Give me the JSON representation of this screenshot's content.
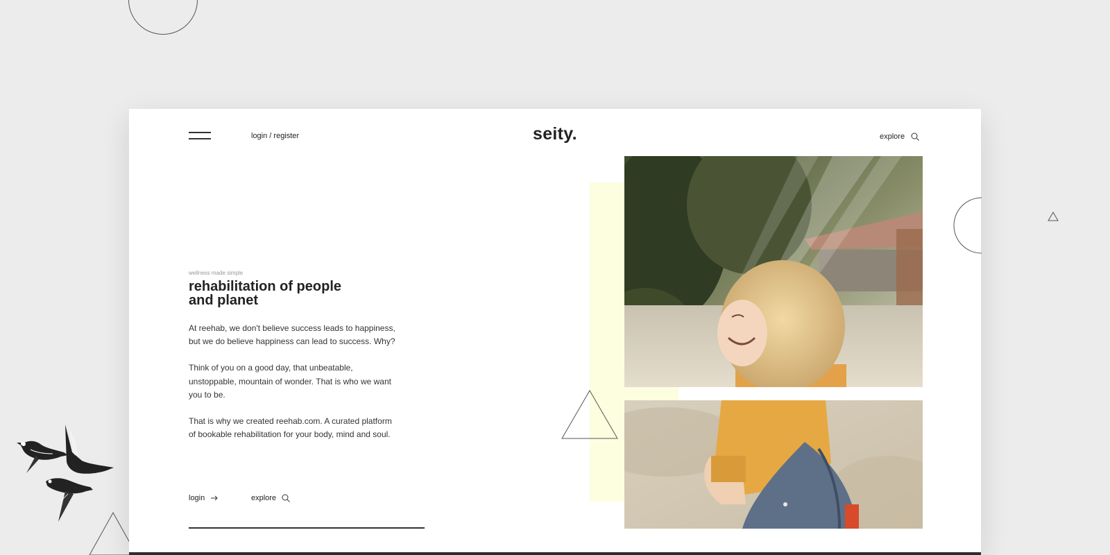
{
  "header": {
    "login_register": "login / register",
    "logo": "seity.",
    "explore": "explore"
  },
  "hero": {
    "eyebrow": "wellness made simple",
    "headline_line1": "rehabilitation of people",
    "headline_line2": "and planet",
    "paragraphs": [
      "At reehab, we don't believe success leads to happiness, but we do believe happiness can lead to success. Why?",
      "Think of you on a good day, that unbeatable, unstoppable, mountain of wonder. That is who we want you to be.",
      "That is why we created reehab.com. A curated platform of bookable rehabilitation for your body, mind and soul."
    ]
  },
  "cta": {
    "login": "login",
    "explore": "explore"
  },
  "icons": {
    "menu": "hamburger-menu-icon",
    "search": "search-icon",
    "arrow": "arrow-right-icon"
  },
  "colors": {
    "background": "#ececec",
    "card": "#ffffff",
    "accent_yellow": "#fdfde0",
    "text": "#222222",
    "footer_bar": "#2a2d33"
  }
}
